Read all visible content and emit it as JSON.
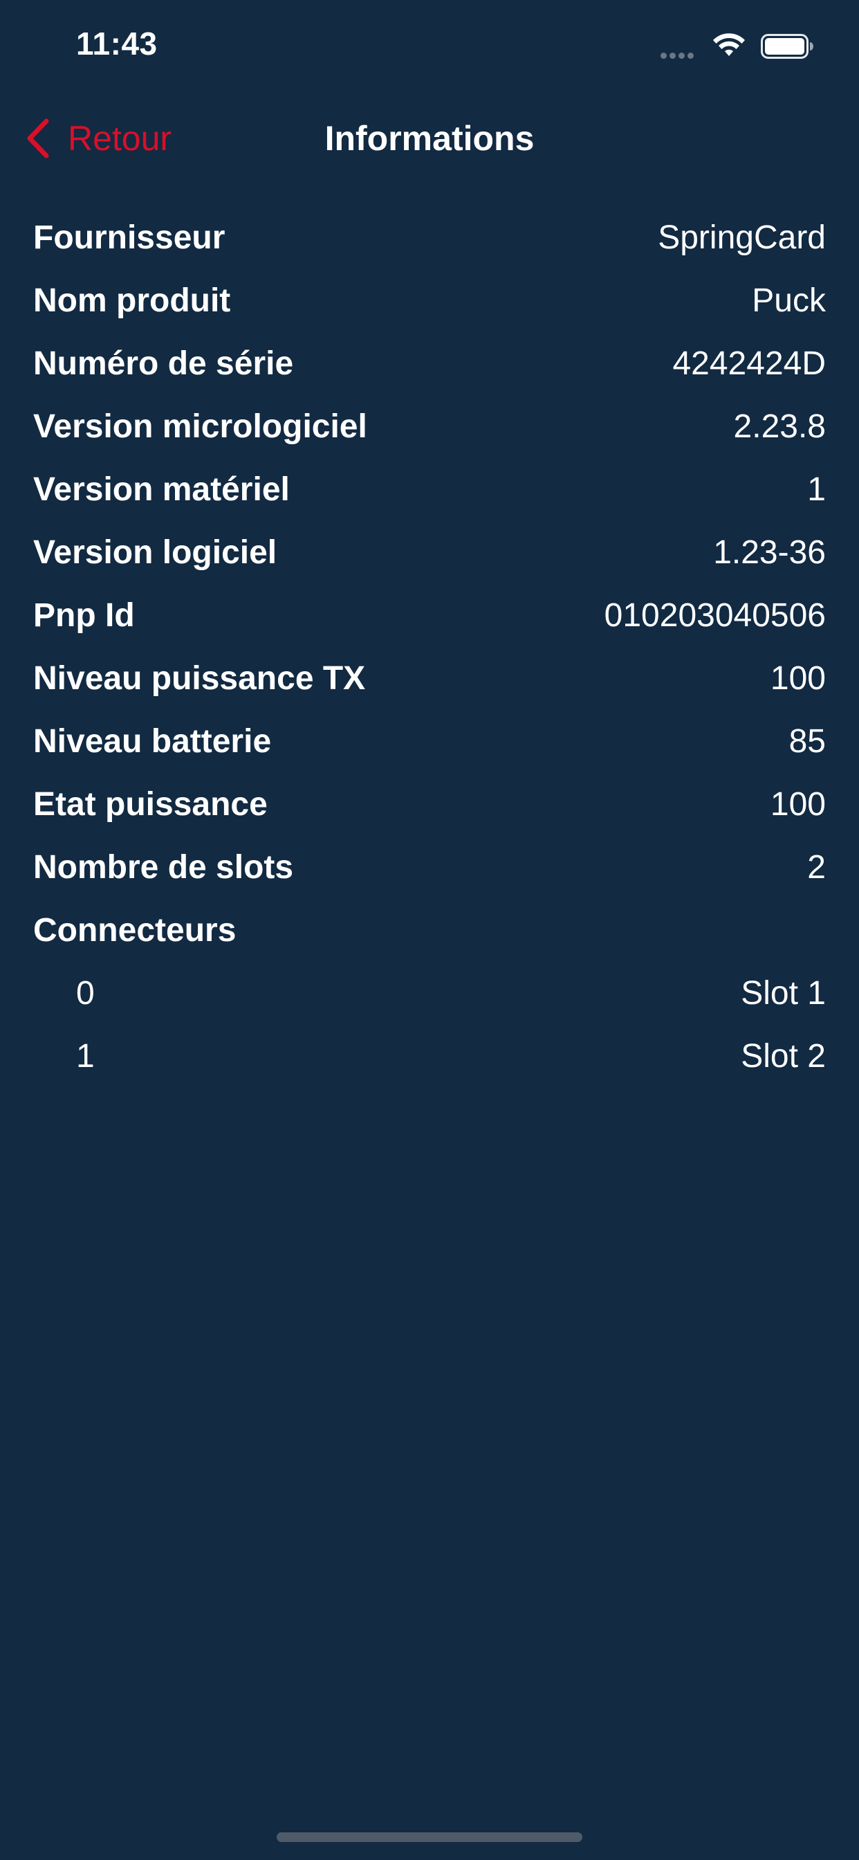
{
  "status_bar": {
    "time": "11:43"
  },
  "nav": {
    "back_label": "Retour",
    "title": "Informations"
  },
  "info_rows": [
    {
      "label": "Fournisseur",
      "value": "SpringCard"
    },
    {
      "label": "Nom produit",
      "value": "Puck"
    },
    {
      "label": "Numéro de série",
      "value": "4242424D"
    },
    {
      "label": "Version micrologiciel",
      "value": "2.23.8"
    },
    {
      "label": "Version matériel",
      "value": "1"
    },
    {
      "label": "Version logiciel",
      "value": "1.23-36"
    },
    {
      "label": "Pnp Id",
      "value": "010203040506"
    },
    {
      "label": "Niveau puissance TX",
      "value": "100"
    },
    {
      "label": "Niveau batterie",
      "value": "85"
    },
    {
      "label": "Etat puissance",
      "value": "100"
    },
    {
      "label": "Nombre de slots",
      "value": "2"
    }
  ],
  "connectors": {
    "label": "Connecteurs",
    "items": [
      {
        "index": "0",
        "name": "Slot 1"
      },
      {
        "index": "1",
        "name": "Slot 2"
      }
    ]
  },
  "colors": {
    "background": "#122a42",
    "accent": "#d8102a",
    "text": "#ffffff"
  },
  "icons": {
    "back": "chevron-left-icon",
    "wifi": "wifi-icon",
    "battery": "battery-icon",
    "signal": "signal-dots-icon"
  }
}
